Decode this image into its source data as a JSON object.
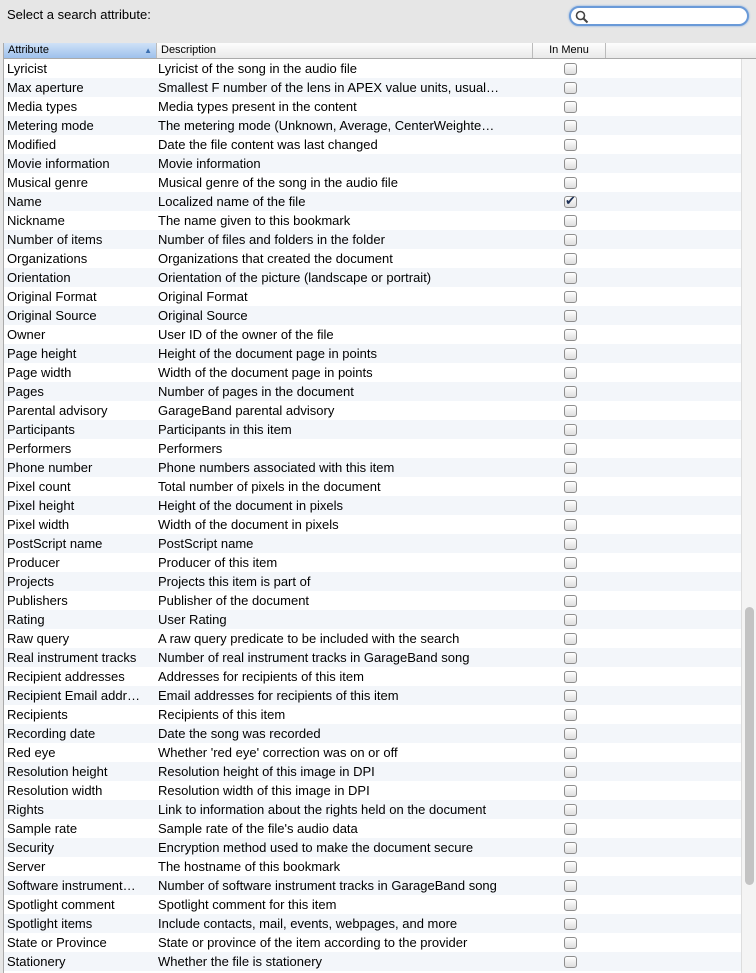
{
  "title": "Select a search attribute:",
  "search": {
    "placeholder": "",
    "value": ""
  },
  "columns": [
    "Attribute",
    "Description",
    "In Menu"
  ],
  "rows": [
    [
      "Lyricist",
      "Lyricist of the song in the audio file",
      false
    ],
    [
      "Max aperture",
      "Smallest F number of the lens in APEX value units, usual…",
      false
    ],
    [
      "Media types",
      "Media types present in the content",
      false
    ],
    [
      "Metering mode",
      "The metering mode (Unknown, Average, CenterWeighte…",
      false
    ],
    [
      "Modified",
      "Date the file content was last changed",
      false
    ],
    [
      "Movie information",
      "Movie information",
      false
    ],
    [
      "Musical genre",
      "Musical genre of the song in the audio file",
      false
    ],
    [
      "Name",
      "Localized name of the file",
      true
    ],
    [
      "Nickname",
      "The name given to this bookmark",
      false
    ],
    [
      "Number of items",
      "Number of files and folders in the folder",
      false
    ],
    [
      "Organizations",
      "Organizations that created the document",
      false
    ],
    [
      "Orientation",
      "Orientation of the picture (landscape or portrait)",
      false
    ],
    [
      "Original Format",
      "Original Format",
      false
    ],
    [
      "Original Source",
      "Original Source",
      false
    ],
    [
      "Owner",
      "User ID of the owner of the file",
      false
    ],
    [
      "Page height",
      "Height of the document page in points",
      false
    ],
    [
      "Page width",
      "Width of the document page in points",
      false
    ],
    [
      "Pages",
      "Number of pages in the document",
      false
    ],
    [
      "Parental advisory",
      "GarageBand parental advisory",
      false
    ],
    [
      "Participants",
      "Participants in this item",
      false
    ],
    [
      "Performers",
      "Performers",
      false
    ],
    [
      "Phone number",
      "Phone numbers associated with this item",
      false
    ],
    [
      "Pixel count",
      "Total number of pixels in the document",
      false
    ],
    [
      "Pixel height",
      "Height of the document in pixels",
      false
    ],
    [
      "Pixel width",
      "Width of the document in pixels",
      false
    ],
    [
      "PostScript name",
      "PostScript name",
      false
    ],
    [
      "Producer",
      "Producer of this item",
      false
    ],
    [
      "Projects",
      "Projects this item is part of",
      false
    ],
    [
      "Publishers",
      "Publisher of the document",
      false
    ],
    [
      "Rating",
      "User Rating",
      false
    ],
    [
      "Raw query",
      "A raw query predicate to be included with the search",
      false
    ],
    [
      "Real instrument tracks",
      "Number of real instrument tracks in GarageBand song",
      false
    ],
    [
      "Recipient addresses",
      "Addresses for recipients of this item",
      false
    ],
    [
      "Recipient Email addr…",
      "Email addresses for recipients of this item",
      false
    ],
    [
      "Recipients",
      "Recipients of this item",
      false
    ],
    [
      "Recording date",
      "Date the song was recorded",
      false
    ],
    [
      "Red eye",
      "Whether 'red eye' correction was on or off",
      false
    ],
    [
      "Resolution height",
      "Resolution height of this image in DPI",
      false
    ],
    [
      "Resolution width",
      "Resolution width of this image in DPI",
      false
    ],
    [
      "Rights",
      "Link to information about the rights held on the document",
      false
    ],
    [
      "Sample rate",
      "Sample rate of the file's audio data",
      false
    ],
    [
      "Security",
      "Encryption method used to make the document secure",
      false
    ],
    [
      "Server",
      "The hostname of this bookmark",
      false
    ],
    [
      "Software instrument…",
      "Number of software instrument tracks in GarageBand song",
      false
    ],
    [
      "Spotlight comment",
      "Spotlight comment for this item",
      false
    ],
    [
      "Spotlight items",
      "Include contacts, mail, events, webpages, and more",
      false
    ],
    [
      "State or Province",
      "State or province of the item according to the provider",
      false
    ],
    [
      "Stationery",
      "Whether the file is stationery",
      false
    ]
  ],
  "colors": {
    "accent": "#9ec1ec",
    "row_alt": "#f3f6fa"
  },
  "icons": {
    "search": "magnifier-icon",
    "sort": "sort-ascending-icon",
    "check": "checkmark-icon"
  }
}
